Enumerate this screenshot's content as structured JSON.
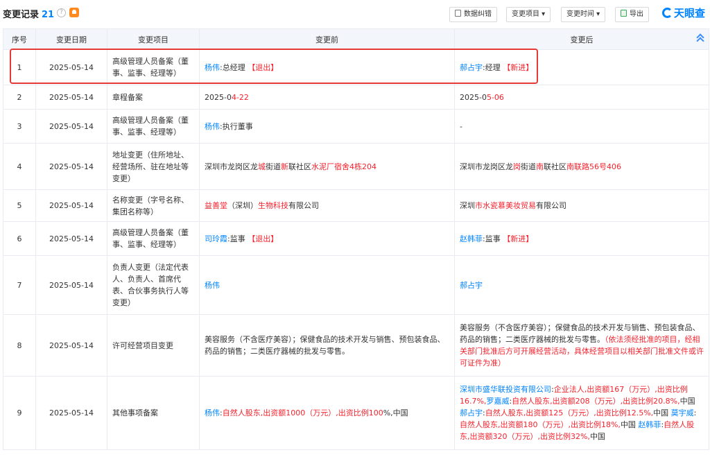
{
  "header": {
    "title": "变更记录",
    "count": "21",
    "help_glyph": "?",
    "buttons": {
      "data_correct": "数据纠错",
      "change_item": "变更项目 ▾",
      "change_time": "变更时间 ▾",
      "export": "导出"
    },
    "logo": "天眼查"
  },
  "table": {
    "columns": [
      "序号",
      "变更日期",
      "变更项目",
      "变更前",
      "变更后"
    ],
    "rows": [
      {
        "no": "1",
        "date": "2025-05-14",
        "item": "高级管理人员备案（董事、监事、经理等）",
        "before": [
          {
            "t": "杨伟",
            "c": "blue"
          },
          {
            "t": ":总经理 ",
            "c": ""
          },
          {
            "t": "【退出】",
            "c": "red"
          }
        ],
        "after": [
          {
            "t": "郝占宇",
            "c": "blue"
          },
          {
            "t": ":经理 ",
            "c": ""
          },
          {
            "t": "【新进】",
            "c": "red"
          }
        ]
      },
      {
        "no": "2",
        "date": "2025-05-14",
        "item": "章程备案",
        "before": [
          {
            "t": "2025-0",
            "c": ""
          },
          {
            "t": "4-22",
            "c": "red"
          }
        ],
        "after": [
          {
            "t": "2025-0",
            "c": ""
          },
          {
            "t": "5-06",
            "c": "red"
          }
        ]
      },
      {
        "no": "3",
        "date": "2025-05-14",
        "item": "高级管理人员备案（董事、监事、经理等）",
        "before": [
          {
            "t": "杨伟",
            "c": "blue"
          },
          {
            "t": ":执行董事",
            "c": ""
          }
        ],
        "after": [
          {
            "t": "-",
            "c": ""
          }
        ]
      },
      {
        "no": "4",
        "date": "2025-05-14",
        "item": "地址变更（住所地址、经营场所、驻在地址等变更）",
        "before": [
          {
            "t": "深圳市龙岗区龙",
            "c": ""
          },
          {
            "t": "城",
            "c": "red"
          },
          {
            "t": "街道",
            "c": ""
          },
          {
            "t": "新",
            "c": "red"
          },
          {
            "t": "联社区",
            "c": ""
          },
          {
            "t": "水泥厂宿舍4栋204",
            "c": "red"
          }
        ],
        "after": [
          {
            "t": "深圳市龙岗区龙",
            "c": ""
          },
          {
            "t": "岗",
            "c": "red"
          },
          {
            "t": "街道",
            "c": ""
          },
          {
            "t": "南",
            "c": "red"
          },
          {
            "t": "联社区",
            "c": ""
          },
          {
            "t": "南联路56号406",
            "c": "red"
          }
        ]
      },
      {
        "no": "5",
        "date": "2025-05-14",
        "item": "名称变更（字号名称、集团名称等）",
        "before": [
          {
            "t": "益善堂",
            "c": "red"
          },
          {
            "t": "（深圳）",
            "c": ""
          },
          {
            "t": "生物科技",
            "c": "red"
          },
          {
            "t": "有限公司",
            "c": ""
          }
        ],
        "after": [
          {
            "t": "深圳",
            "c": ""
          },
          {
            "t": "市水瓷慕美妆贸易",
            "c": "red"
          },
          {
            "t": "有限公司",
            "c": ""
          }
        ]
      },
      {
        "no": "6",
        "date": "2025-05-14",
        "item": "高级管理人员备案（董事、监事、经理等）",
        "before": [
          {
            "t": "司玲霞",
            "c": "blue"
          },
          {
            "t": ":监事 ",
            "c": ""
          },
          {
            "t": "【退出】",
            "c": "red"
          }
        ],
        "after": [
          {
            "t": "赵韩菲",
            "c": "blue"
          },
          {
            "t": ":监事 ",
            "c": ""
          },
          {
            "t": "【新进】",
            "c": "red"
          }
        ]
      },
      {
        "no": "7",
        "date": "2025-05-14",
        "item": "负责人变更（法定代表人、负责人、首席代表、合伙事务执行人等变更）",
        "before": [
          {
            "t": "杨伟",
            "c": "blue"
          }
        ],
        "after": [
          {
            "t": "郝占宇",
            "c": "blue"
          }
        ]
      },
      {
        "no": "8",
        "date": "2025-05-14",
        "item": "许可经营项目变更",
        "before": [
          {
            "t": "美容服务（不含医疗美容）；保健食品的技术开发与销售、预包装食品、药品的销售；二类医疗器械的批发与零售。",
            "c": ""
          }
        ],
        "after": [
          {
            "t": "美容服务（不含医疗美容）；保健食品的技术开发与销售、预包装食品、药品的销售；二类医疗器械的批发与零售。",
            "c": ""
          },
          {
            "t": "（依法须经批准的项目，经相关部门批准后方可开展经营活动，具体经营项目以相关部门批准文件或许可证件为准）",
            "c": "red"
          }
        ]
      },
      {
        "no": "9",
        "date": "2025-05-14",
        "item": "其他事项备案",
        "before": [
          {
            "t": "杨伟",
            "c": "blue"
          },
          {
            "t": ":",
            "c": ""
          },
          {
            "t": "自然人股东,出资额1000（万元）,出资比例100",
            "c": "red"
          },
          {
            "t": "%,中国",
            "c": ""
          }
        ],
        "after": [
          {
            "t": "深圳市盛华联投资有限公司",
            "c": "blue"
          },
          {
            "t": ":",
            "c": ""
          },
          {
            "t": "企业法人,出资额167（万元）,出资比例16.7%,",
            "c": "red"
          },
          {
            "t": "罗嘉威",
            "c": "blue"
          },
          {
            "t": ":",
            "c": ""
          },
          {
            "t": "自然人股东,出资额208（万元）,出资比例20.8%,",
            "c": "red"
          },
          {
            "t": "中国 ",
            "c": ""
          },
          {
            "t": "郝占宇",
            "c": "blue"
          },
          {
            "t": ":",
            "c": ""
          },
          {
            "t": "自然人股东,出资额125（万元）,出资比例12.5%,",
            "c": "red"
          },
          {
            "t": "中国 ",
            "c": ""
          },
          {
            "t": "莫宇威",
            "c": "blue"
          },
          {
            "t": ":",
            "c": ""
          },
          {
            "t": "自然人股东,出资额180（万元）,出资比例18%,",
            "c": "red"
          },
          {
            "t": "中国 ",
            "c": ""
          },
          {
            "t": "赵韩菲",
            "c": "blue"
          },
          {
            "t": ":",
            "c": ""
          },
          {
            "t": "自然人股东,出资额320（万元）,出资比例32%,",
            "c": "red"
          },
          {
            "t": "中国",
            "c": ""
          }
        ]
      }
    ]
  }
}
